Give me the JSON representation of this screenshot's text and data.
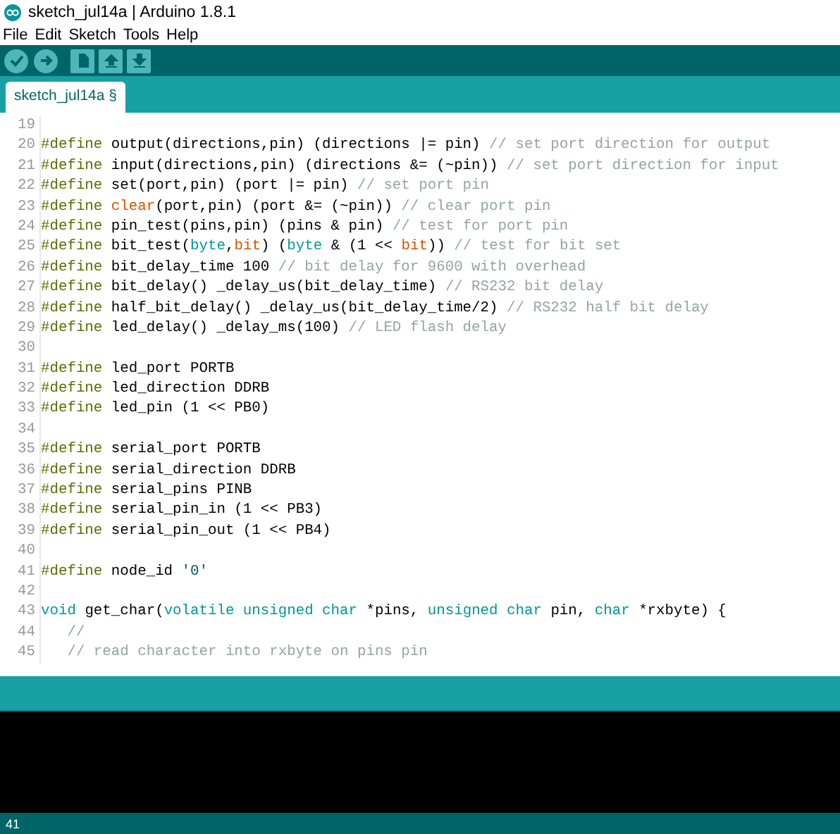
{
  "window": {
    "title": "sketch_jul14a | Arduino 1.8.1"
  },
  "menu": [
    "File",
    "Edit",
    "Sketch",
    "Tools",
    "Help"
  ],
  "toolbar": [
    {
      "kind": "verify"
    },
    {
      "kind": "upload"
    },
    {
      "kind": "new"
    },
    {
      "kind": "open"
    },
    {
      "kind": "save"
    }
  ],
  "tabs": [
    {
      "label": "sketch_jul14a §",
      "selected": true
    }
  ],
  "editor": {
    "lines": [
      {
        "number": "19"
      },
      {
        "number": "20",
        "tokens": [
          {
            "kind": "keyword",
            "text": "#define"
          },
          {
            "kind": "plain",
            "text": " output(directions,pin) (directions |= pin) "
          },
          {
            "kind": "comment",
            "text": "// set port direction for output"
          }
        ]
      },
      {
        "number": "21",
        "tokens": [
          {
            "kind": "keyword",
            "text": "#define"
          },
          {
            "kind": "plain",
            "text": " input(directions,pin) (directions &= (~pin)) "
          },
          {
            "kind": "comment",
            "text": "// set port direction for input"
          }
        ]
      },
      {
        "number": "22",
        "tokens": [
          {
            "kind": "keyword",
            "text": "#define"
          },
          {
            "kind": "plain",
            "text": " set(port,pin) (port |= pin) "
          },
          {
            "kind": "comment",
            "text": "// set port pin"
          }
        ]
      },
      {
        "number": "23",
        "tokens": [
          {
            "kind": "keyword",
            "text": "#define"
          },
          {
            "kind": "function",
            "text": " clear"
          },
          {
            "kind": "plain",
            "text": "(port,pin) (port &= (~pin)) "
          },
          {
            "kind": "comment",
            "text": "// clear port pin"
          }
        ]
      },
      {
        "number": "24",
        "tokens": [
          {
            "kind": "keyword",
            "text": "#define"
          },
          {
            "kind": "plain",
            "text": " pin_test(pins,pin) (pins & pin) "
          },
          {
            "kind": "comment",
            "text": "// test for port pin"
          }
        ]
      },
      {
        "number": "25",
        "tokens": [
          {
            "kind": "keyword",
            "text": "#define"
          },
          {
            "kind": "plain",
            "text": " bit_test("
          },
          {
            "kind": "type",
            "text": "byte"
          },
          {
            "kind": "plain",
            "text": ","
          },
          {
            "kind": "function",
            "text": "bit"
          },
          {
            "kind": "plain",
            "text": ") ("
          },
          {
            "kind": "type",
            "text": "byte"
          },
          {
            "kind": "plain",
            "text": " & (1 << "
          },
          {
            "kind": "function",
            "text": "bit"
          },
          {
            "kind": "plain",
            "text": ")) "
          },
          {
            "kind": "comment",
            "text": "// test for bit set"
          }
        ]
      },
      {
        "number": "26",
        "tokens": [
          {
            "kind": "keyword",
            "text": "#define"
          },
          {
            "kind": "plain",
            "text": " bit_delay_time 100 "
          },
          {
            "kind": "comment",
            "text": "// bit delay for 9600 with overhead"
          }
        ]
      },
      {
        "number": "27",
        "tokens": [
          {
            "kind": "keyword",
            "text": "#define"
          },
          {
            "kind": "plain",
            "text": " bit_delay() _delay_us(bit_delay_time) "
          },
          {
            "kind": "comment",
            "text": "// RS232 bit delay"
          }
        ]
      },
      {
        "number": "28",
        "tokens": [
          {
            "kind": "keyword",
            "text": "#define"
          },
          {
            "kind": "plain",
            "text": " half_bit_delay() _delay_us(bit_delay_time/2) "
          },
          {
            "kind": "comment",
            "text": "// RS232 half bit delay"
          }
        ]
      },
      {
        "number": "29",
        "tokens": [
          {
            "kind": "keyword",
            "text": "#define"
          },
          {
            "kind": "plain",
            "text": " led_delay() _delay_ms(100) "
          },
          {
            "kind": "comment",
            "text": "// LED flash delay"
          }
        ]
      },
      {
        "number": "30"
      },
      {
        "number": "31",
        "tokens": [
          {
            "kind": "keyword",
            "text": "#define"
          },
          {
            "kind": "plain",
            "text": " led_port PORTB"
          }
        ]
      },
      {
        "number": "32",
        "tokens": [
          {
            "kind": "keyword",
            "text": "#define"
          },
          {
            "kind": "plain",
            "text": " led_direction DDRB"
          }
        ]
      },
      {
        "number": "33",
        "tokens": [
          {
            "kind": "keyword",
            "text": "#define"
          },
          {
            "kind": "plain",
            "text": " led_pin (1 << PB0)"
          }
        ]
      },
      {
        "number": "34"
      },
      {
        "number": "35",
        "tokens": [
          {
            "kind": "keyword",
            "text": "#define"
          },
          {
            "kind": "plain",
            "text": " serial_port PORTB"
          }
        ]
      },
      {
        "number": "36",
        "tokens": [
          {
            "kind": "keyword",
            "text": "#define"
          },
          {
            "kind": "plain",
            "text": " serial_direction DDRB"
          }
        ]
      },
      {
        "number": "37",
        "tokens": [
          {
            "kind": "keyword",
            "text": "#define"
          },
          {
            "kind": "plain",
            "text": " serial_pins PINB"
          }
        ]
      },
      {
        "number": "38",
        "tokens": [
          {
            "kind": "keyword",
            "text": "#define"
          },
          {
            "kind": "plain",
            "text": " serial_pin_in (1 << PB3)"
          }
        ]
      },
      {
        "number": "39",
        "tokens": [
          {
            "kind": "keyword",
            "text": "#define"
          },
          {
            "kind": "plain",
            "text": " serial_pin_out (1 << PB4)"
          }
        ]
      },
      {
        "number": "40"
      },
      {
        "number": "41",
        "tokens": [
          {
            "kind": "keyword",
            "text": "#define"
          },
          {
            "kind": "plain",
            "text": " node_id "
          },
          {
            "kind": "literal",
            "text": "'0'"
          }
        ]
      },
      {
        "number": "42"
      },
      {
        "number": "43",
        "tokens": [
          {
            "kind": "type",
            "text": "void"
          },
          {
            "kind": "plain",
            "text": " get_char("
          },
          {
            "kind": "type",
            "text": "volatile unsigned char"
          },
          {
            "kind": "plain",
            "text": " *pins, "
          },
          {
            "kind": "type",
            "text": "unsigned char"
          },
          {
            "kind": "plain",
            "text": " pin, "
          },
          {
            "kind": "type",
            "text": "char"
          },
          {
            "kind": "plain",
            "text": " *rxbyte) {"
          }
        ]
      },
      {
        "number": "44",
        "tokens": [
          {
            "kind": "comment",
            "text": "   //"
          }
        ]
      },
      {
        "number": "45",
        "tokens": [
          {
            "kind": "comment",
            "text": "   // read character into rxbyte on pins pin"
          }
        ]
      }
    ]
  },
  "status_bar": {
    "line": "41"
  }
}
